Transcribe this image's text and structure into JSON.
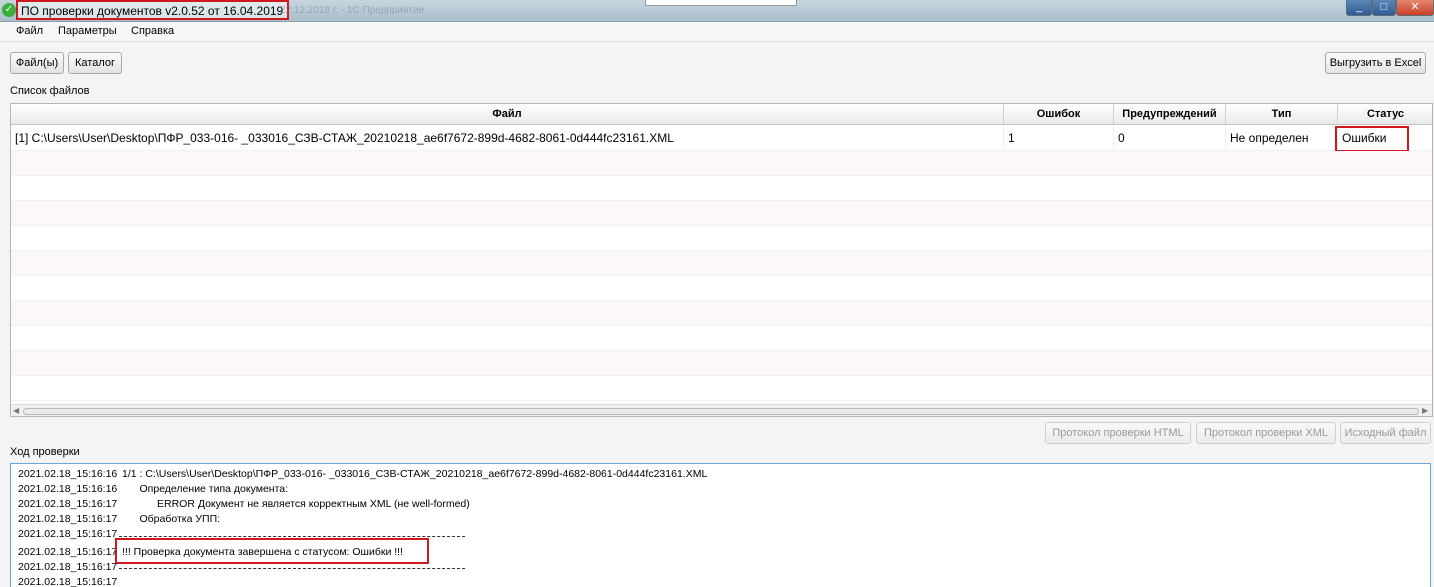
{
  "window": {
    "title": "ПО проверки документов  v2.0.52 от 16.04.2019",
    "background_text": "22.12.2018 г. - 1С:Предприятие",
    "controls": {
      "minimize": "_",
      "maximize": "□",
      "close": "✕"
    },
    "icon": "check-icon"
  },
  "menu": {
    "items": [
      "Файл",
      "Параметры",
      "Справка"
    ]
  },
  "toolbar": {
    "files_button": "Файл(ы)",
    "catalog_button": "Каталог",
    "export_button": "Выгрузить в Excel"
  },
  "file_list": {
    "label": "Список файлов",
    "columns": [
      "Файл",
      "Ошибок",
      "Предупреждений",
      "Тип",
      "Статус"
    ],
    "rows": [
      {
        "file": "[1] C:\\Users\\User\\Desktop\\ПФР_033-016-              _033016_СЗВ-СТАЖ_20210218_ae6f7672-899d-4682-8061-0d444fc23161.XML",
        "errors": "1",
        "warnings": "0",
        "type": "Не определен",
        "status": "Ошибки"
      }
    ]
  },
  "report_buttons": {
    "html_report": "Протокол проверки HTML",
    "xml_report": "Протокол проверки XML",
    "source_file": "Исходный файл"
  },
  "log": {
    "label": "Ход проверки",
    "lines": [
      {
        "ts": "2021.02.18_15:16:16",
        "text": "1/1  : C:\\Users\\User\\Desktop\\ПФР_033-016-              _033016_СЗВ-СТАЖ_20210218_ae6f7672-899d-4682-8061-0d444fc23161.XML"
      },
      {
        "ts": "2021.02.18_15:16:16",
        "text": "      Определение типа документа:"
      },
      {
        "ts": "2021.02.18_15:16:17",
        "text": "            ERROR Документ не является корректным XML (не well-formed)"
      },
      {
        "ts": "2021.02.18_15:16:17",
        "text": "      Обработка УПП:"
      },
      {
        "ts": "2021.02.18_15:16:17",
        "text": ""
      },
      {
        "ts": "2021.02.18_15:16:17",
        "text": "!!!  Проверка документа завершена с статусом: Ошибки  !!!"
      },
      {
        "ts": "2021.02.18_15:16:17",
        "text": ""
      },
      {
        "ts": "2021.02.18_15:16:17",
        "text": ""
      }
    ]
  }
}
